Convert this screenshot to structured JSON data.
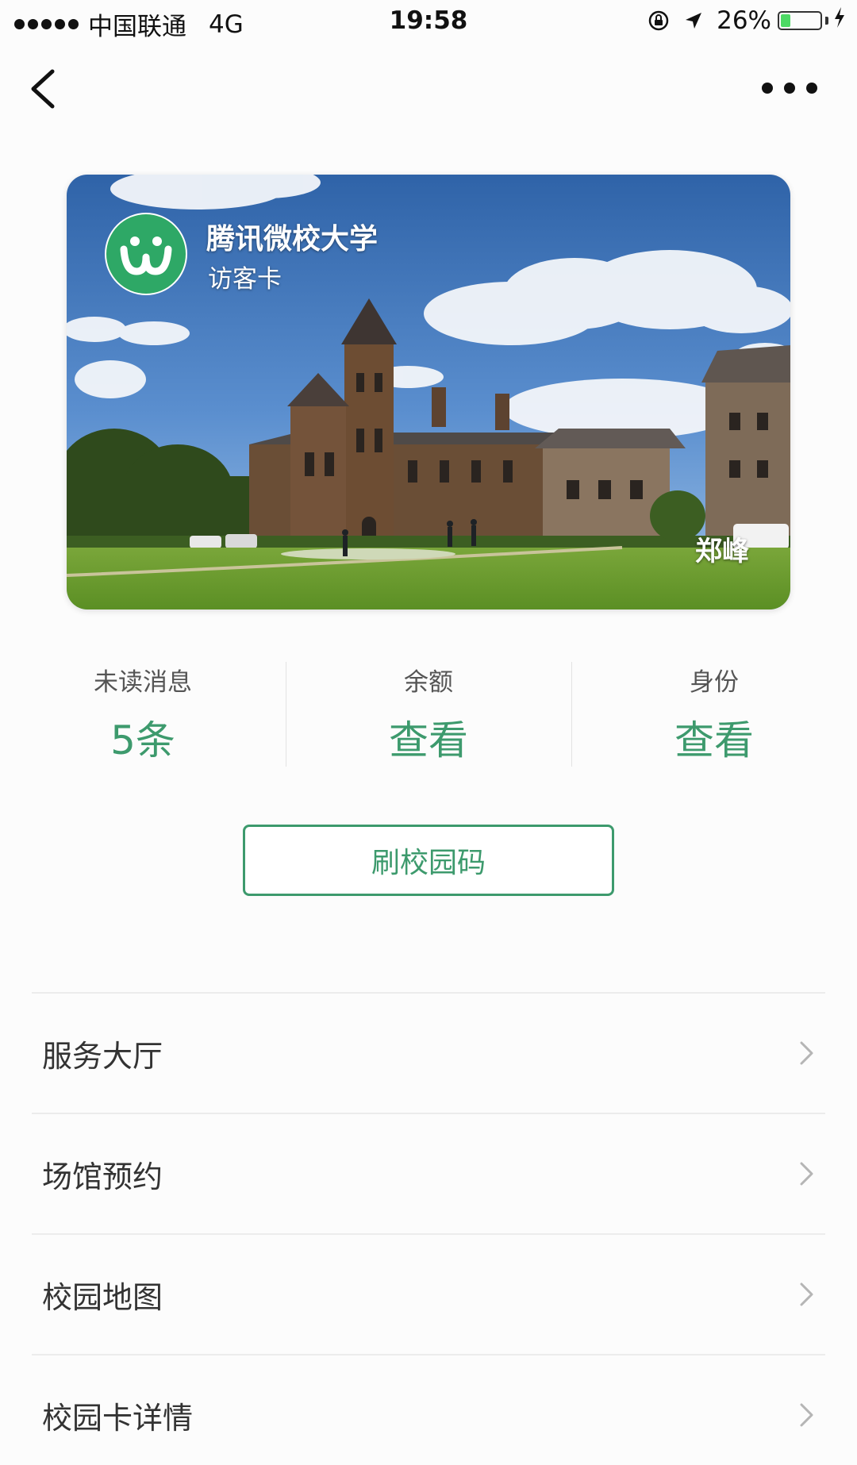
{
  "status_bar": {
    "carrier": "中国联通",
    "network": "4G",
    "time": "19:58",
    "battery_percent": "26%",
    "battery_level": 0.26,
    "icons": [
      "signal-dots-icon",
      "orientation-lock-icon",
      "location-arrow-icon",
      "battery-icon",
      "charging-bolt-icon"
    ]
  },
  "nav": {
    "back_icon": "back-chevron-icon",
    "more_icon": "more-dots-icon"
  },
  "card": {
    "school_name": "腾讯微校大学",
    "card_type": "访客卡",
    "holder_name": "郑峰",
    "logo_icon": "weixiao-logo-icon",
    "colors": {
      "logo_green": "#2ea866"
    }
  },
  "stats": [
    {
      "label": "未读消息",
      "value": "5条"
    },
    {
      "label": "余额",
      "value": "查看"
    },
    {
      "label": "身份",
      "value": "查看"
    }
  ],
  "campus_code_button": {
    "label": "刷校园码"
  },
  "menu": [
    {
      "label": "服务大厅"
    },
    {
      "label": "场馆预约"
    },
    {
      "label": "校园地图"
    },
    {
      "label": "校园卡详情"
    }
  ],
  "colors": {
    "accent_green": "#3d9a6d",
    "background": "#fcfcfc",
    "divider": "#ececec"
  }
}
